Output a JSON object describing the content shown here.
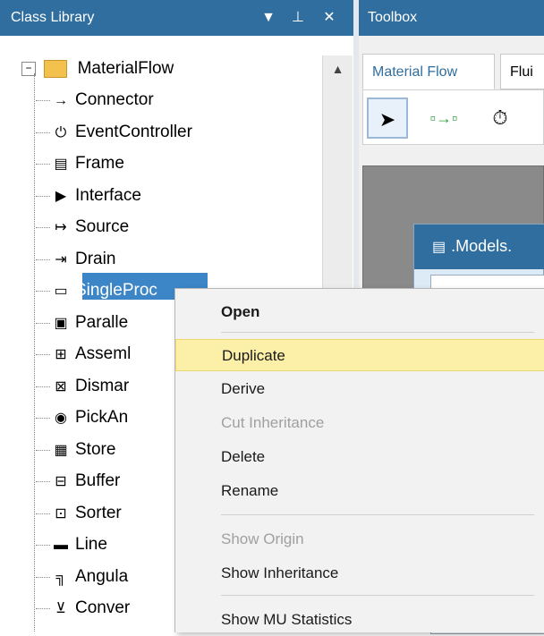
{
  "class_library": {
    "title": "Class Library",
    "header_icons": [
      "chevron-down-icon",
      "pin-icon",
      "close-icon"
    ],
    "root": {
      "label": "MaterialFlow",
      "expander": "⊟"
    },
    "items": [
      {
        "label": "Connector",
        "icon": "connector-icon"
      },
      {
        "label": "EventController",
        "icon": "event-controller-icon"
      },
      {
        "label": "Frame",
        "icon": "frame-icon"
      },
      {
        "label": "Interface",
        "icon": "interface-icon"
      },
      {
        "label": "Source",
        "icon": "source-icon"
      },
      {
        "label": "Drain",
        "icon": "drain-icon"
      },
      {
        "label": "SingleProc",
        "icon": "singleproc-icon"
      },
      {
        "label": "Paralle",
        "icon": "parallelproc-icon"
      },
      {
        "label": "Asseml",
        "icon": "assembly-icon"
      },
      {
        "label": "Dismar",
        "icon": "dismantle-icon"
      },
      {
        "label": "PickAn",
        "icon": "pickandplace-icon"
      },
      {
        "label": "Store",
        "icon": "store-icon"
      },
      {
        "label": "Buffer",
        "icon": "buffer-icon"
      },
      {
        "label": "Sorter",
        "icon": "sorter-icon"
      },
      {
        "label": "Line",
        "icon": "line-icon"
      },
      {
        "label": "Angula",
        "icon": "angular-converter-icon"
      },
      {
        "label": "Conver",
        "icon": "converter-icon"
      }
    ]
  },
  "toolbox": {
    "title": "Toolbox",
    "tabs": [
      "Material Flow",
      "Flui"
    ],
    "tools": [
      "pointer-icon",
      "connector-tool-icon",
      "stopwatch-icon"
    ]
  },
  "model_window": {
    "title": ".Models."
  },
  "context_menu": {
    "items": [
      {
        "label": "Open",
        "bold": true,
        "disabled": false
      },
      {
        "label": "Duplicate",
        "bold": false,
        "disabled": false,
        "highlighted": true
      },
      {
        "label": "Derive",
        "bold": false,
        "disabled": false
      },
      {
        "label": "Cut Inheritance",
        "bold": false,
        "disabled": true
      },
      {
        "label": "Delete",
        "bold": false,
        "disabled": false
      },
      {
        "label": "Rename",
        "bold": false,
        "disabled": false
      },
      {
        "label": "Show Origin",
        "bold": false,
        "disabled": true
      },
      {
        "label": "Show Inheritance",
        "bold": false,
        "disabled": false
      },
      {
        "label": "Show MU Statistics",
        "bold": false,
        "disabled": false
      }
    ]
  },
  "colors": {
    "header_bg": "#2f6e9f",
    "highlight": "#fcefa8",
    "selection": "#3c86c7"
  }
}
